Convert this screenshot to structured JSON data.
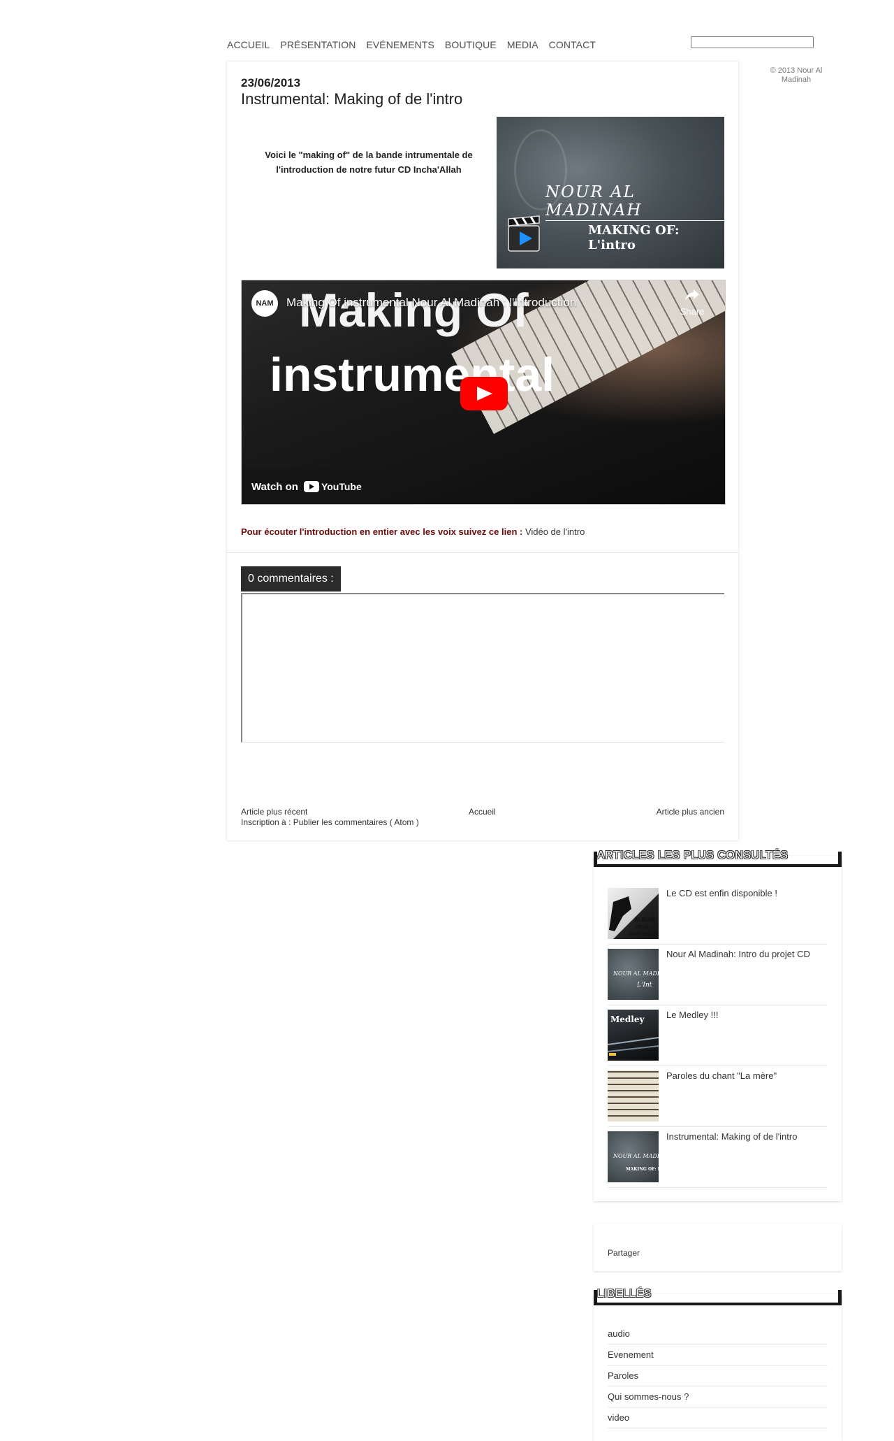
{
  "nav": {
    "items": [
      "ACCUEIL",
      "PRÉSENTATION",
      "EVÉNEMENTS",
      "BOUTIQUE",
      "MEDIA",
      "CONTACT"
    ]
  },
  "search": {
    "value": "",
    "placeholder": ""
  },
  "copyright": "© 2013 Nour Al Madinah",
  "post": {
    "date": "23/06/2013",
    "title": "Instrumental: Making of de l'intro",
    "intro": "Voici le \"making of\" de la bande intrumentale de l'introduction de notre futur CD Incha'Allah",
    "banner": {
      "logo_text": "NOUR AL MADINAH",
      "subtitle": "MAKING OF: L'intro"
    },
    "video": {
      "title": "Making Of instrumental Nour Al Madinah : l'Introduction",
      "overlay_line1": "Making Of",
      "overlay_line2": "instrumental",
      "share_label": "Share",
      "watch_label": "Watch on",
      "youtube_label": "YouTube",
      "avatar_text": "NAM"
    },
    "listen_text": "Pour écouter l'introduction en entier avec les voix suivez ce lien : ",
    "listen_link": "Vidéo de l'intro",
    "comments_tab": "0 commentaires :",
    "footer": {
      "newer": "Article plus récent",
      "home": "Accueil",
      "older": "Article plus ancien",
      "subscribe": "Inscription à : Publier les commentaires ( Atom )"
    }
  },
  "sidebar": {
    "popular": {
      "title": "ARTICLES LES PLUS CONSULTÉS",
      "items": [
        {
          "label": "Le CD est enfin disponible !",
          "thumb_text": "ALBUM DÉJÀ DISPONIBLE"
        },
        {
          "label": "Nour Al Madinah: Intro du projet CD",
          "thumb_text": "NOUR AL MADINAH L'Intro"
        },
        {
          "label": "Le Medley !!!",
          "thumb_text": "Medley"
        },
        {
          "label": "Paroles du chant \"La mère\"",
          "thumb_text": ""
        },
        {
          "label": "Instrumental: Making of de l'intro",
          "thumb_text": "NOUR AL MADINAH MAKING OF: L'I"
        }
      ]
    },
    "share": {
      "label": "Partager"
    },
    "labels": {
      "title": "LIBELLÉS",
      "items": [
        "audio",
        "Evenement",
        "Paroles",
        "Qui sommes-nous ?",
        "video"
      ]
    }
  }
}
